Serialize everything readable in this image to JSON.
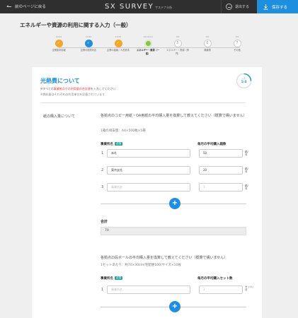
{
  "header": {
    "back_label": "前のページに戻る",
    "logo": "SX SURVEY",
    "logo_sub": "サステナ分析",
    "exit_label": "退出する",
    "save_label": "保存する",
    "accent": "#1e8fe0"
  },
  "page_title": "エネルギーや資源の利用に関する入力（一般）",
  "steps": [
    {
      "date": "10/10",
      "label": "企業基本情報",
      "state": "done"
    },
    {
      "date": "10/10",
      "label": "企業の環境対応",
      "state": "done"
    },
    {
      "date": "10/10",
      "label": "企業の組織／人的資本",
      "state": "done"
    },
    {
      "date": "10/10/10",
      "label": "エネルギー・資源（一般）",
      "state": "current"
    },
    {
      "date": "0/0",
      "label": "エネルギー・資源（専門）",
      "number": "5",
      "state": "todo"
    },
    {
      "date": "0/0",
      "label": "廃棄物",
      "number": "6",
      "state": "todo"
    },
    {
      "date": "0/0",
      "label": "その他",
      "number": "7",
      "state": "todo"
    }
  ],
  "section": {
    "title": "光熱費について",
    "note_prefix": "※すべての",
    "note_red": "事業拠点での利用量の合計値",
    "note_suffix": "を入力してください",
    "note2": "※燃料量はそれぞれの利用単位を記載されています",
    "progress_label": "入力",
    "progress_value": "1/4",
    "progress_fraction": 0.25
  },
  "question1": {
    "label": "紙の購入量について",
    "text": "各拠点のコピー用紙・OA用紙の平均購入量を換算して教えてください（概算で構いません）",
    "sub": "1箱の目安量：A4×500枚×5冊",
    "col_name": "事業所名",
    "required": "必須",
    "col_amount": "毎月の平均購入箱数",
    "rows": [
      {
        "num": "1",
        "name": "本社",
        "amount": "50",
        "unit": "箱/月"
      },
      {
        "num": "2",
        "name": "東京支社",
        "amount": "20",
        "unit": "箱/月"
      },
      {
        "num": "3",
        "name": "事業所名",
        "amount": "1",
        "unit": "箱/月"
      }
    ],
    "add_label": "+",
    "total_label": "合計",
    "total_value": "70"
  },
  "question2": {
    "text": "各拠点の段ボールの平均購入量を換算して教えてください（概算で構いません）",
    "sub": "1セットあたり：約70×30cm(宅配便100)サイズ×10枚",
    "col_name": "事業所名",
    "required": "必須",
    "col_amount": "毎月の平均購入セット数",
    "rows": [
      {
        "num": "1",
        "name": "事業所名",
        "amount": "1",
        "unit": "セット/月"
      }
    ],
    "add_label": "+"
  }
}
